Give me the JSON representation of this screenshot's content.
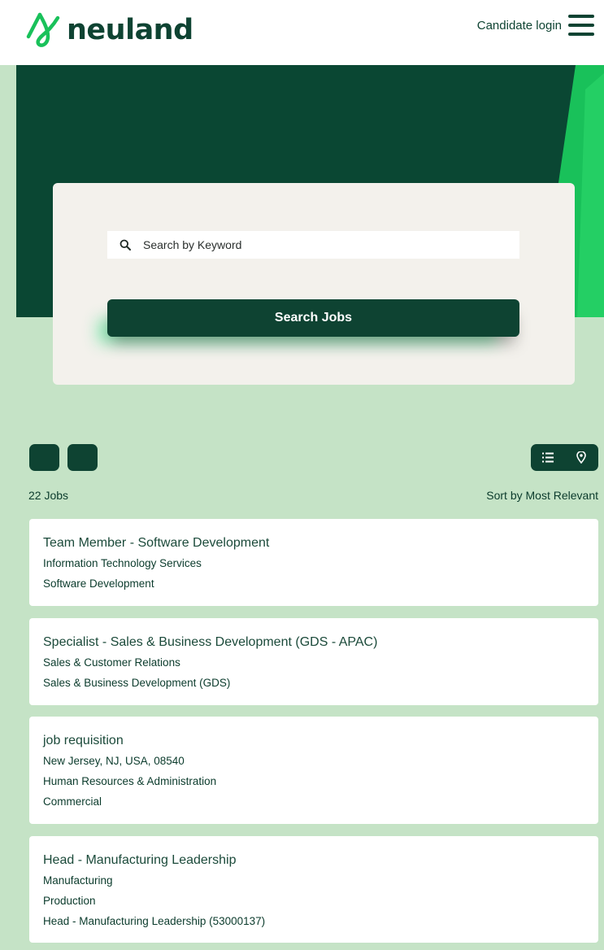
{
  "header": {
    "logo_text": "neuland",
    "login_label": "Candidate login"
  },
  "search": {
    "placeholder": "Search by Keyword",
    "button_label": "Search Jobs"
  },
  "results": {
    "count_label": "22 Jobs",
    "sort_label": "Sort by Most Relevant"
  },
  "jobs": [
    {
      "title": "Team Member - Software Development",
      "lines": [
        "Information Technology Services",
        "Software Development"
      ]
    },
    {
      "title": "Specialist - Sales & Business Development (GDS - APAC)",
      "lines": [
        "Sales & Customer Relations",
        "Sales & Business Development (GDS)"
      ]
    },
    {
      "title": "job requisition",
      "lines": [
        "New Jersey, NJ, USA, 08540",
        "Human Resources & Administration",
        "Commercial"
      ]
    },
    {
      "title": "Head - Manufacturing Leadership",
      "lines": [
        "Manufacturing",
        "Production",
        "Head - Manufacturing Leadership (53000137)"
      ]
    }
  ],
  "colors": {
    "brand_dark": "#0e4332",
    "brand_green": "#19c15a",
    "page_background": "#c5e3c6",
    "card_background": "#f3f1ec"
  }
}
